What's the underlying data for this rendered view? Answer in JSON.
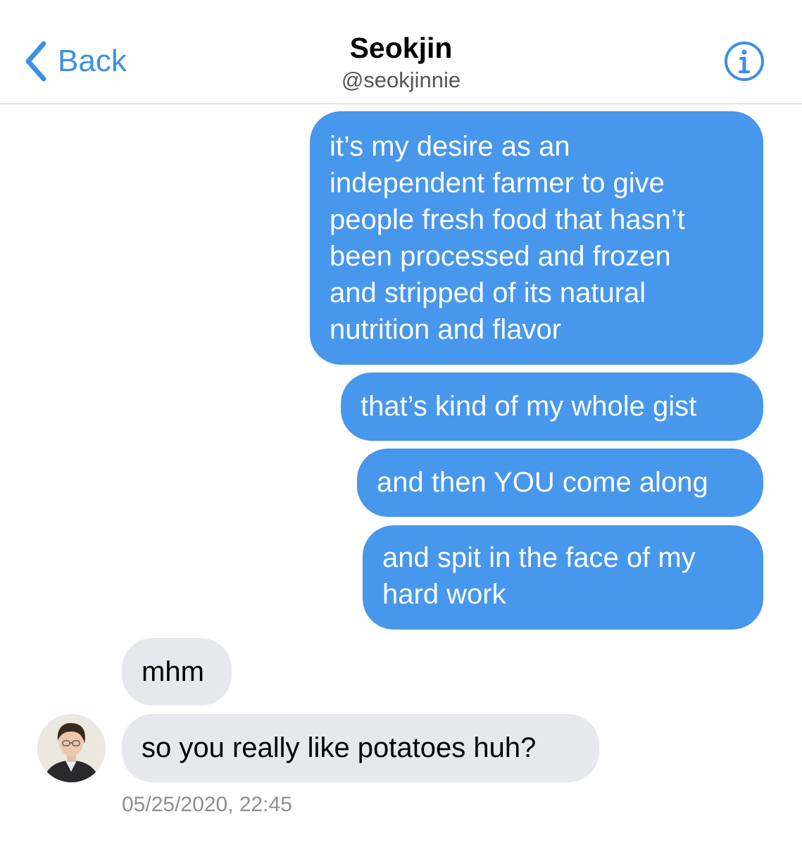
{
  "header": {
    "back_label": "Back",
    "title": "Seokjin",
    "handle": "@seokjinnie",
    "icons": {
      "back": "chevron-left-icon",
      "info": "info-icon"
    },
    "accent_color": "#3d8fe6"
  },
  "messages": [
    {
      "direction": "outgoing",
      "text": "it’s my desire as an\nindependent farmer to give\npeople fresh food that hasn’t\nbeen processed and frozen\nand stripped of its natural\nnutrition and flavor"
    },
    {
      "direction": "outgoing",
      "text": "that’s kind of my whole gist"
    },
    {
      "direction": "outgoing",
      "text": "and then YOU come along"
    },
    {
      "direction": "outgoing",
      "text": "and spit in the face of my\nhard work"
    },
    {
      "direction": "incoming",
      "text": "mhm"
    },
    {
      "direction": "incoming",
      "text": "so you really like potatoes huh?"
    }
  ],
  "timestamp": "05/25/2020, 22:45",
  "colors": {
    "outgoing_bubble": "#4797ec",
    "incoming_bubble": "#e7e8ee",
    "timestamp": "#8e8e93"
  }
}
